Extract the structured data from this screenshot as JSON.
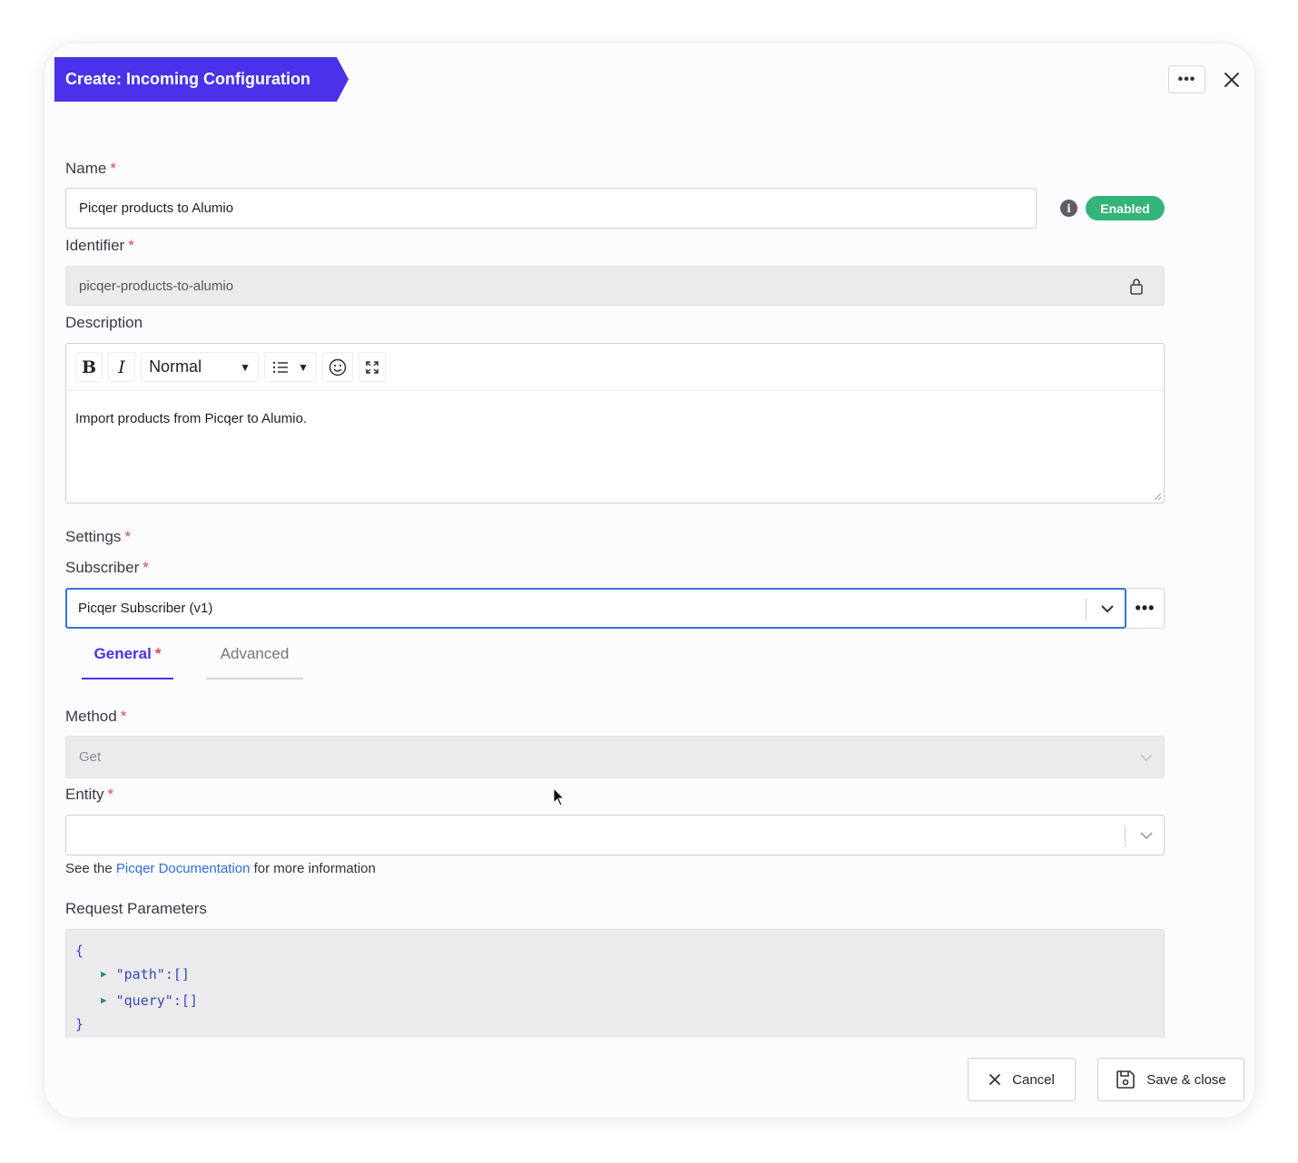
{
  "modal": {
    "title": "Create: Incoming Configuration",
    "more_label": "•••",
    "close_icon": "close-icon"
  },
  "name": {
    "label": "Name",
    "required": "*",
    "value": "Picqer products to Alumio",
    "status_badge": "Enabled",
    "info_icon": "i"
  },
  "identifier": {
    "label": "Identifier",
    "required": "*",
    "value": "picqer-products-to-alumio",
    "icon": "lock-icon"
  },
  "description": {
    "label": "Description",
    "toolbar": {
      "bold": "B",
      "italic": "I",
      "format_select": "Normal"
    },
    "value": "Import products from Picqer to Alumio."
  },
  "settings": {
    "label": "Settings",
    "required": "*"
  },
  "subscriber": {
    "label": "Subscriber",
    "required": "*",
    "value": "Picqer Subscriber (v1)",
    "more_label": "•••"
  },
  "tabs": [
    {
      "label": "General",
      "required": "*",
      "active": true
    },
    {
      "label": "Advanced",
      "active": false
    }
  ],
  "method": {
    "label": "Method",
    "required": "*",
    "value": "Get"
  },
  "entity": {
    "label": "Entity",
    "required": "*",
    "value": "",
    "help_prefix": "See the ",
    "help_link": "Picqer Documentation",
    "help_suffix": " for more information"
  },
  "request_parameters": {
    "label": "Request Parameters",
    "open_brace": "{",
    "close_brace": "}",
    "entries": [
      {
        "key": "\"path\"",
        "sep": " : ",
        "value": "[]"
      },
      {
        "key": "\"query\"",
        "sep": " : ",
        "value": "[]"
      }
    ]
  },
  "footer": {
    "cancel_label": "Cancel",
    "save_label": "Save & close"
  },
  "colors": {
    "accent": "#4a32ea",
    "enabled": "#34b37a",
    "required": "#e0474c",
    "link": "#2f6fd6",
    "focus": "#3b6fe0"
  }
}
